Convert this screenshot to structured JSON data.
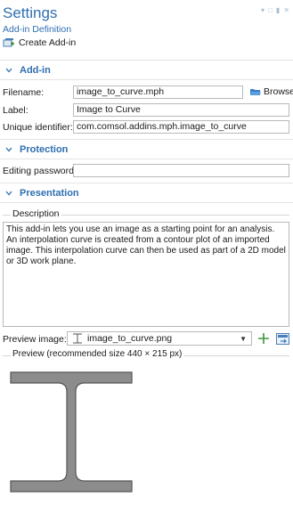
{
  "header": {
    "title": "Settings",
    "subtitle": "Add-in Definition",
    "create_label": "Create Add-in"
  },
  "addin_section": {
    "title": "Add-in",
    "filename_label": "Filename:",
    "filename_value": "image_to_curve.mph",
    "browse_label": "Browse",
    "label_label": "Label:",
    "label_value": "Image to Curve",
    "uid_label": "Unique identifier:",
    "uid_value": "com.comsol.addins.mph.image_to_curve"
  },
  "protection_section": {
    "title": "Protection",
    "password_label": "Editing password:",
    "password_value": ""
  },
  "presentation_section": {
    "title": "Presentation",
    "description_title": "Description",
    "description_text": "This add-in lets you use an image as a starting point for an analysis. An interpolation curve is created from a contour plot of an imported image. This interpolation curve can then be used as part of a 2D model or 3D work plane.",
    "preview_image_label": "Preview image:",
    "preview_image_value": "image_to_curve.png",
    "preview_title": "Preview (recommended size 440 × 215 px)"
  },
  "colors": {
    "accent": "#2e6fb0",
    "beam_fill": "#8c8c8c",
    "beam_stroke": "#555555",
    "add_green": "#3a9a3a"
  }
}
